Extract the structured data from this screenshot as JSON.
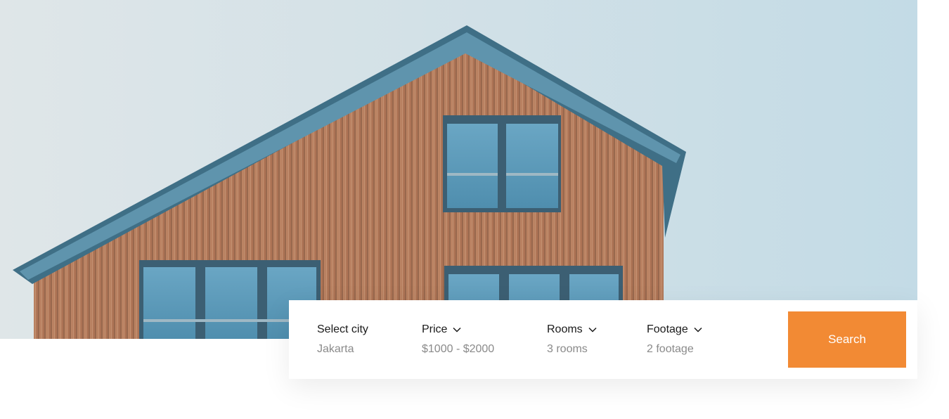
{
  "hero": {
    "image": "wooden-house-photo"
  },
  "search": {
    "city": {
      "label": "Select city",
      "value": "Jakarta"
    },
    "price": {
      "label": "Price",
      "value": "$1000 - $2000",
      "icon": "chevron-down-icon"
    },
    "rooms": {
      "label": "Rooms",
      "value": "3 rooms",
      "icon": "chevron-down-icon"
    },
    "footage": {
      "label": "Footage",
      "value": "2 footage",
      "icon": "chevron-down-icon"
    },
    "button_label": "Search"
  },
  "colors": {
    "accent": "#f28a34",
    "label": "#1a1a1a",
    "value": "#8a8a8a"
  }
}
